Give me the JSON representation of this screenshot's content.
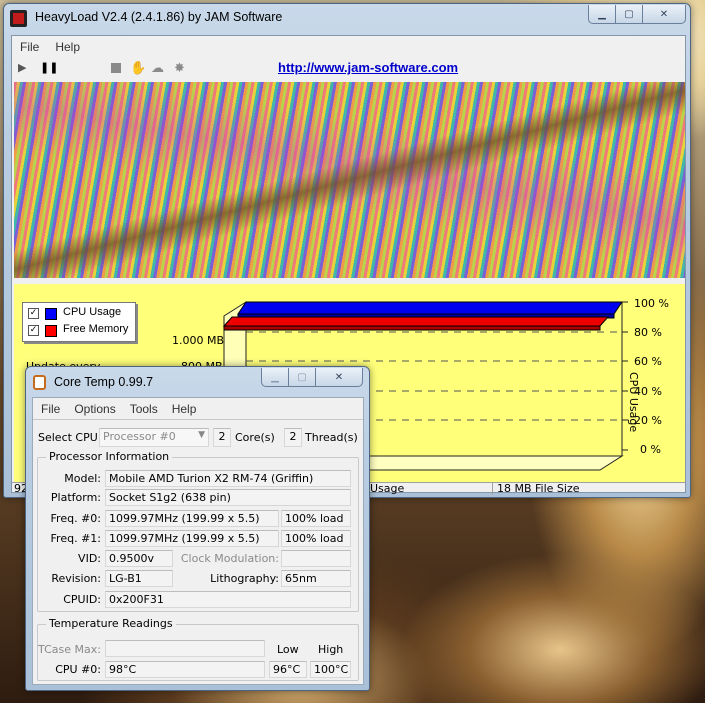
{
  "heavyload": {
    "title": "HeavyLoad V2.4   (2.4.1.86)   by JAM Software",
    "menu": [
      "File",
      "Help"
    ],
    "toolbar": {
      "link": "http://www.jam-software.com"
    },
    "legend": {
      "cpu_label": "CPU Usage",
      "mem_label": "Free Memory"
    },
    "mem_ticks": [
      "1.000 MB",
      "800 MB"
    ],
    "update_label": "Update every",
    "cpu_axis_title": "CPU Usage",
    "cpu_ticks": [
      "100 %",
      "80 %",
      "60 %",
      "40 %",
      "20 %",
      "0 %"
    ],
    "status": {
      "left": "92",
      "usage": "Usage",
      "file": "18 MB File Size"
    },
    "colors": {
      "cpu": "#0000ff",
      "memory": "#ff0000",
      "chart_bg": "#ffff7a"
    },
    "levels": {
      "cpu_usage_percent": 100,
      "free_memory_percent": 86
    }
  },
  "coretemp": {
    "title": "Core Temp 0.99.7",
    "menu": [
      "File",
      "Options",
      "Tools",
      "Help"
    ],
    "select_cpu": {
      "label": "Select CPU:",
      "value": "Processor #0",
      "cores": "2",
      "cores_label": "Core(s)",
      "threads": "2",
      "threads_label": "Thread(s)"
    },
    "proc_info": {
      "title": "Processor Information",
      "model_label": "Model:",
      "model": "Mobile AMD Turion X2 RM-74 (Griffin)",
      "platform_label": "Platform:",
      "platform": "Socket S1g2 (638 pin)",
      "freq0_label": "Freq. #0:",
      "freq0": "1099.97MHz (199.99 x 5.5)",
      "load0": "100% load",
      "freq1_label": "Freq. #1:",
      "freq1": "1099.97MHz (199.99 x 5.5)",
      "load1": "100% load",
      "vid_label": "VID:",
      "vid": "0.9500v",
      "clockmod_label": "Clock Modulation:",
      "clockmod": "",
      "revision_label": "Revision:",
      "revision": "LG-B1",
      "litho_label": "Lithography:",
      "litho": "65nm",
      "cpuid_label": "CPUID:",
      "cpuid": "0x200F31"
    },
    "temps": {
      "title": "Temperature Readings",
      "tcase_label": "TCase Max:",
      "tcase": "",
      "low_label": "Low",
      "high_label": "High",
      "cpu0_label": "CPU #0:",
      "cpu0": "98°C",
      "cpu0_low": "96°C",
      "cpu0_high": "100°C"
    }
  }
}
